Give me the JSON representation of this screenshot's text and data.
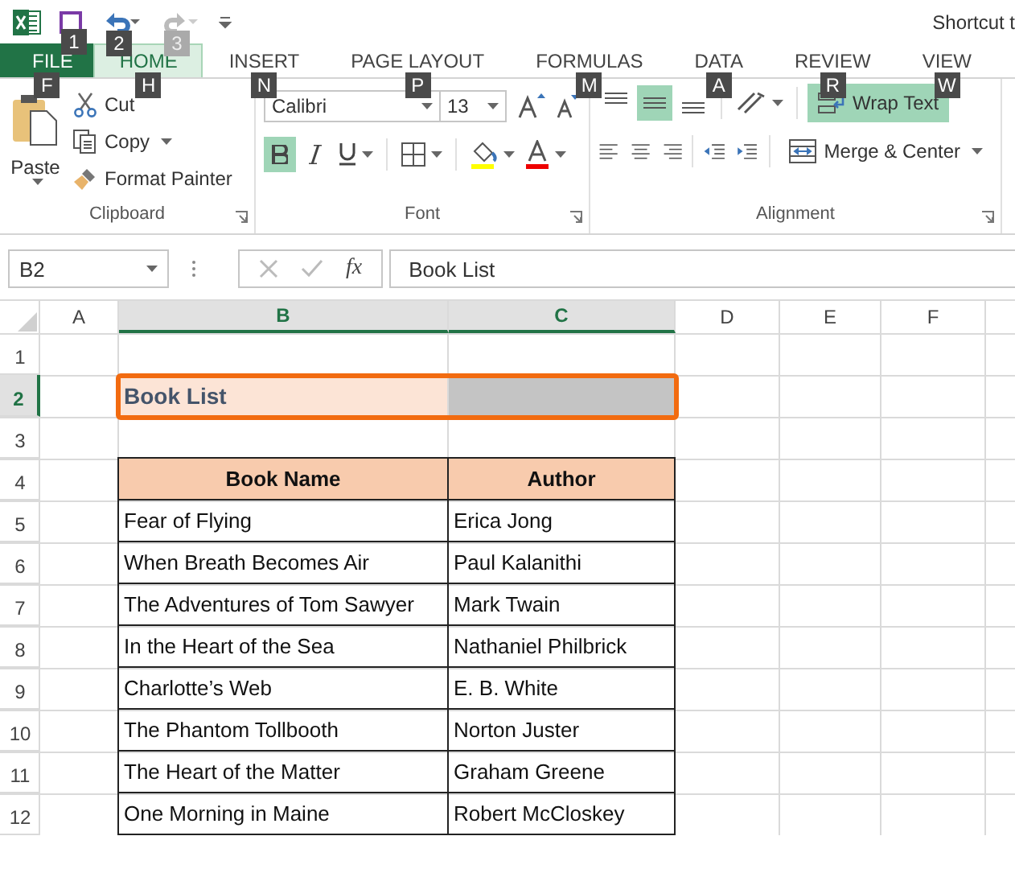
{
  "title_bar": {
    "quick_access": [
      {
        "kind": "save",
        "keytip": "1",
        "disabled": false
      },
      {
        "kind": "undo",
        "keytip": "2",
        "disabled": false
      },
      {
        "kind": "redo",
        "keytip": "3",
        "disabled": true
      }
    ],
    "title": "Shortcut t"
  },
  "tabs": [
    {
      "label": "FILE",
      "keytip": "F",
      "kind": "file",
      "selected": false
    },
    {
      "label": "HOME",
      "keytip": "H",
      "kind": "tab",
      "selected": true
    },
    {
      "label": "INSERT",
      "keytip": "N",
      "kind": "tab",
      "selected": false
    },
    {
      "label": "PAGE LAYOUT",
      "keytip": "P",
      "kind": "tab",
      "selected": false
    },
    {
      "label": "FORMULAS",
      "keytip": "M",
      "kind": "tab",
      "selected": false
    },
    {
      "label": "DATA",
      "keytip": "A",
      "kind": "tab",
      "selected": false
    },
    {
      "label": "REVIEW",
      "keytip": "R",
      "kind": "tab",
      "selected": false
    },
    {
      "label": "VIEW",
      "keytip": "W",
      "kind": "tab",
      "selected": false
    }
  ],
  "ribbon": {
    "clipboard": {
      "paste": "Paste",
      "cut": "Cut",
      "copy": "Copy",
      "format_painter": "Format Painter",
      "label": "Clipboard"
    },
    "font": {
      "font_name": "Calibri",
      "font_size": "13",
      "bold": true,
      "italic": false,
      "underline": false,
      "label": "Font"
    },
    "alignment": {
      "vertical": [
        {
          "kind": "top",
          "selected": false
        },
        {
          "kind": "middle",
          "selected": true
        },
        {
          "kind": "bottom",
          "selected": false
        }
      ],
      "wrap_text": {
        "label": "Wrap Text",
        "selected": true
      },
      "merge_center": "Merge & Center",
      "label": "Alignment"
    }
  },
  "formula_bar": {
    "name_box": "B2",
    "function_label": "fx",
    "value": "Book List"
  },
  "sheet": {
    "columns": [
      {
        "label": "A",
        "selected": false
      },
      {
        "label": "B",
        "selected": true
      },
      {
        "label": "C",
        "selected": true
      },
      {
        "label": "D",
        "selected": false
      },
      {
        "label": "E",
        "selected": false
      },
      {
        "label": "F",
        "selected": false
      }
    ],
    "rows": [
      {
        "number": "1",
        "selected": false,
        "kind": "blank",
        "cells": []
      },
      {
        "number": "2",
        "selected": true,
        "kind": "title",
        "cells": [
          "",
          "Book List"
        ]
      },
      {
        "number": "3",
        "selected": false,
        "kind": "blank",
        "cells": []
      },
      {
        "number": "4",
        "selected": false,
        "kind": "header",
        "cells": [
          "",
          "Book Name",
          "Author"
        ]
      },
      {
        "number": "5",
        "selected": false,
        "kind": "data",
        "cells": [
          "",
          "Fear of Flying",
          "Erica Jong"
        ]
      },
      {
        "number": "6",
        "selected": false,
        "kind": "data",
        "cells": [
          "",
          "When Breath Becomes Air",
          "Paul Kalanithi"
        ]
      },
      {
        "number": "7",
        "selected": false,
        "kind": "data",
        "cells": [
          "",
          "The Adventures of Tom Sawyer",
          "Mark Twain"
        ]
      },
      {
        "number": "8",
        "selected": false,
        "kind": "data",
        "cells": [
          "",
          "In the Heart of the Sea",
          "Nathaniel Philbrick"
        ]
      },
      {
        "number": "9",
        "selected": false,
        "kind": "data",
        "cells": [
          "",
          "Charlotte’s Web",
          "E. B. White"
        ]
      },
      {
        "number": "10",
        "selected": false,
        "kind": "data",
        "cells": [
          "",
          "The Phantom Tollbooth",
          "Norton Juster"
        ]
      },
      {
        "number": "11",
        "selected": false,
        "kind": "data",
        "cells": [
          "",
          "The Heart of the Matter",
          "Graham Greene"
        ]
      },
      {
        "number": "12",
        "selected": false,
        "kind": "data",
        "cells": [
          "",
          "One Morning in Maine",
          "Robert McCloskey"
        ]
      }
    ]
  }
}
